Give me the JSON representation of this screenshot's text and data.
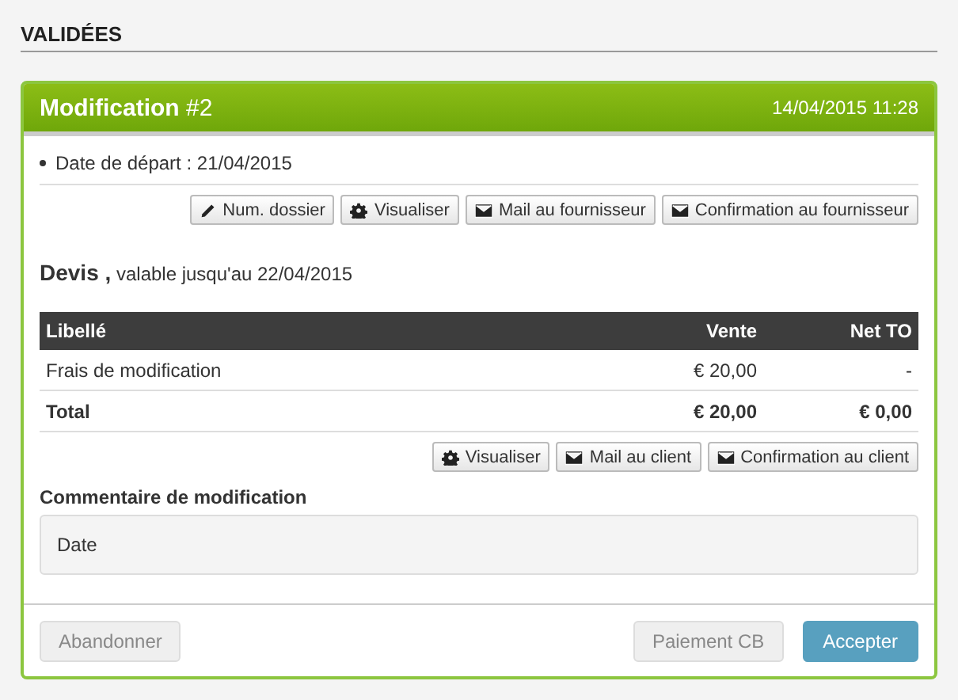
{
  "section_title": "VALIDÉES",
  "card": {
    "title": "**Modification** #2",
    "timestamp": "14/04/2015 11:28",
    "details": [
      "Date de départ : 21/04/2015"
    ],
    "supplier_actions": [
      {
        "label": "Num. dossier",
        "kind": "edit"
      },
      {
        "label": "Visualiser",
        "kind": "view"
      },
      {
        "label": "Mail au fournisseur",
        "kind": "mail"
      },
      {
        "label": "Confirmation au fournisseur",
        "kind": "mail"
      }
    ],
    "quote_heading": "**Devis ,** valable jusqu'au 22/04/2015",
    "table": {
      "columns": [
        "Libellé",
        "Vente",
        "Net TO"
      ],
      "rows": [
        {
          "cells": [
            "Frais de modification",
            "€ 20,00",
            "-"
          ],
          "total": false
        },
        {
          "cells": [
            "Total",
            "€ 20,00",
            "€ 0,00"
          ],
          "total": true
        }
      ]
    },
    "client_actions": [
      {
        "label": "Visualiser",
        "kind": "view"
      },
      {
        "label": "Mail au client",
        "kind": "mail"
      },
      {
        "label": "Confirmation au client",
        "kind": "mail"
      }
    ],
    "comment": {
      "label": "Commentaire de modification",
      "value": "Date"
    },
    "footer": {
      "left": [
        {
          "label": "Abandonner",
          "kind": "default"
        }
      ],
      "right": [
        {
          "label": "Paiement CB",
          "kind": "default"
        },
        {
          "label": "Accepter",
          "kind": "primary"
        }
      ]
    }
  }
}
